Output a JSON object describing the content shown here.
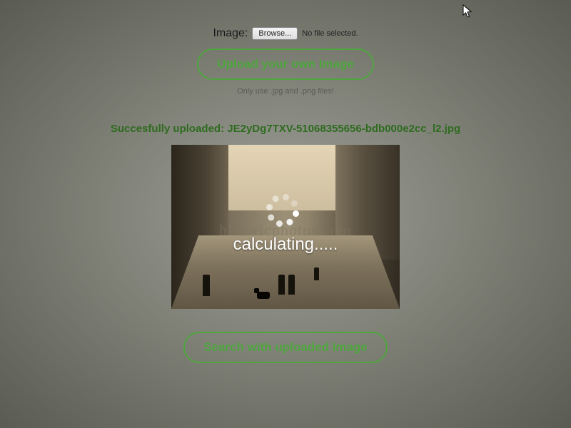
{
  "upload": {
    "label": "Image:",
    "browse_label": "Browse...",
    "no_file_text": "No file selected.",
    "button_label": "Upload your own Image",
    "hint": "Only use .jpg and .png files!"
  },
  "status": {
    "prefix": "Succesfully uploaded: ",
    "filename": "JE2yDg7TXV-51068355656-bdb000e2cc_l2.jpg"
  },
  "overlay": {
    "calculating_label": "calculating....."
  },
  "search": {
    "button_label": "Search with uploaded Image"
  },
  "watermark": "historicphotos.com"
}
